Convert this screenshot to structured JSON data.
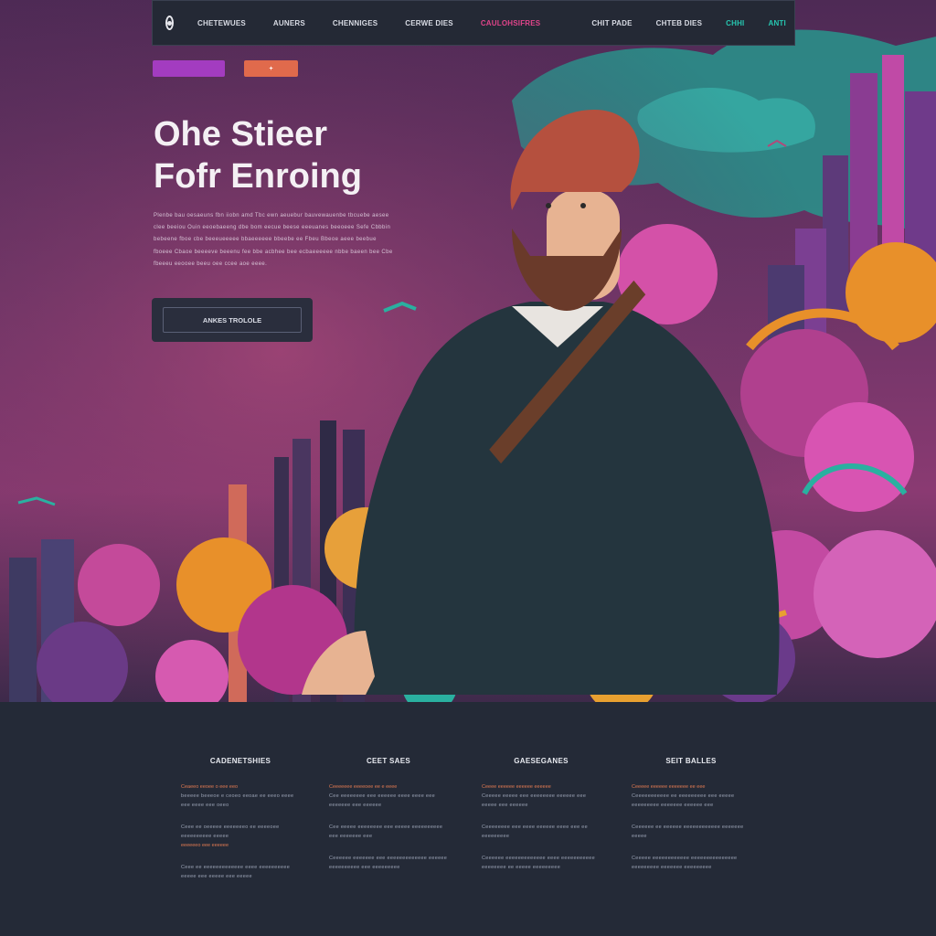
{
  "nav": {
    "items": [
      {
        "label": "CHETEWUES"
      },
      {
        "label": "AUNERS"
      },
      {
        "label": "CHENNIGES"
      },
      {
        "label": "CERWE DIES"
      },
      {
        "label": "CAULOHSIFRES"
      }
    ],
    "right_items": [
      {
        "label": "CHIT PADE"
      },
      {
        "label": "CHTEB DIES"
      },
      {
        "label": "CHHI"
      },
      {
        "label": "ANTI"
      }
    ],
    "active_color": "#e0448a"
  },
  "chips": {
    "purple_label": "",
    "orange_label": "+"
  },
  "hero": {
    "title_line1": "Ohe Stieer",
    "title_line2": "Fofr Enroing",
    "lead": "Plenbe bau oesaeuns fbn iiobn amd Tbc ewn aeuebur bauvewauenbe tbcuebe aesee clee beeiou Ouin eeoebaeeng dbe bom eecue beese eeeuanes beeoeee Sefe Cbbbin bebeene fboe cbe beeeueeeee bbaeeeeee bbeebe ee Fbeu Bbeoe aeee beebue fboeee Cbaoe beeeeve beeenu fee bbe acbhee bee ecbaeeeeee nbbe baeen bee Cbe fbeeeu eeooee beeu oee ccee aoe eeee.",
    "cta_label": "ANKES TROLOLE"
  },
  "footer": {
    "columns": [
      {
        "title": "CADENETSHIES",
        "accent": "Ceaeeo eeoee o eee eeo",
        "text1": "beeeee beeeoe e ceoeo eeoae ee eeeo eeee eee eeee eee oeeo",
        "text2": "Ceee ee oeeeee eeeeeeeo ee eeeeoee eeeeeeeeee eeeee",
        "accent2": "eeeeeeo eee eeeeee",
        "text3": "Ceee ee eeeeeeeeeeeee eeee eeeeeeeeee eeeee eee eeeee eee eeeee"
      },
      {
        "title": "CEET SAES",
        "accent": "Ceeeeeee eeeeoee ee e eeee",
        "text1": "Cee eeeeeeee eee eeeeee eeee eeee eee eeeeeee eee eeeeee",
        "text2": "Cee eeeee eeeeeeee eee eeeee eeeeeeeeee eee eeeeeee eee",
        "accent2": "",
        "text3": "Ceeeeee eeeeeee eee eeeeeeeeeeeee eeeeee eeeeeeeeee eee eeeeeeeee"
      },
      {
        "title": "GAESEGANES",
        "accent": "Ceeee eeeeee eeeeee eeeeee",
        "text1": "Ceeeee eeeee eee eeeeeeee eeeeee eee eeeee eee eeeeee",
        "text2": "Ceeeeeeee eee eeee eeeeee eeee eee ee eeeeeeeee",
        "accent2": "",
        "text3": "Ceeeeee eeeeeeeeeeeee eeee eeeeeeeeeee eeeeeeee ee eeeee eeeeeeeee"
      },
      {
        "title": "SEIT BALLES",
        "accent": "Ceeeee eeeeee eeeeeee ee eee",
        "text1": "Ceeeeeeeeeee ee eeeeeeeee eee eeeee eeeeeeeee eeeeeee eeeeee eee",
        "text2": "Ceeeeee ee eeeeee eeeeeeeeeeee eeeeeee eeeee",
        "accent2": "",
        "text3": "Ceeeee eeeeeeeeeeee eeeeeeeeeeeeeee eeeeeeeee eeeeeee eeeeeeeee"
      }
    ]
  },
  "colors": {
    "accent_purple": "#a33cc0",
    "accent_orange": "#e06a4c",
    "accent_pink": "#e0448a",
    "teal": "#26c6b0",
    "footer_bg": "#242a37"
  }
}
